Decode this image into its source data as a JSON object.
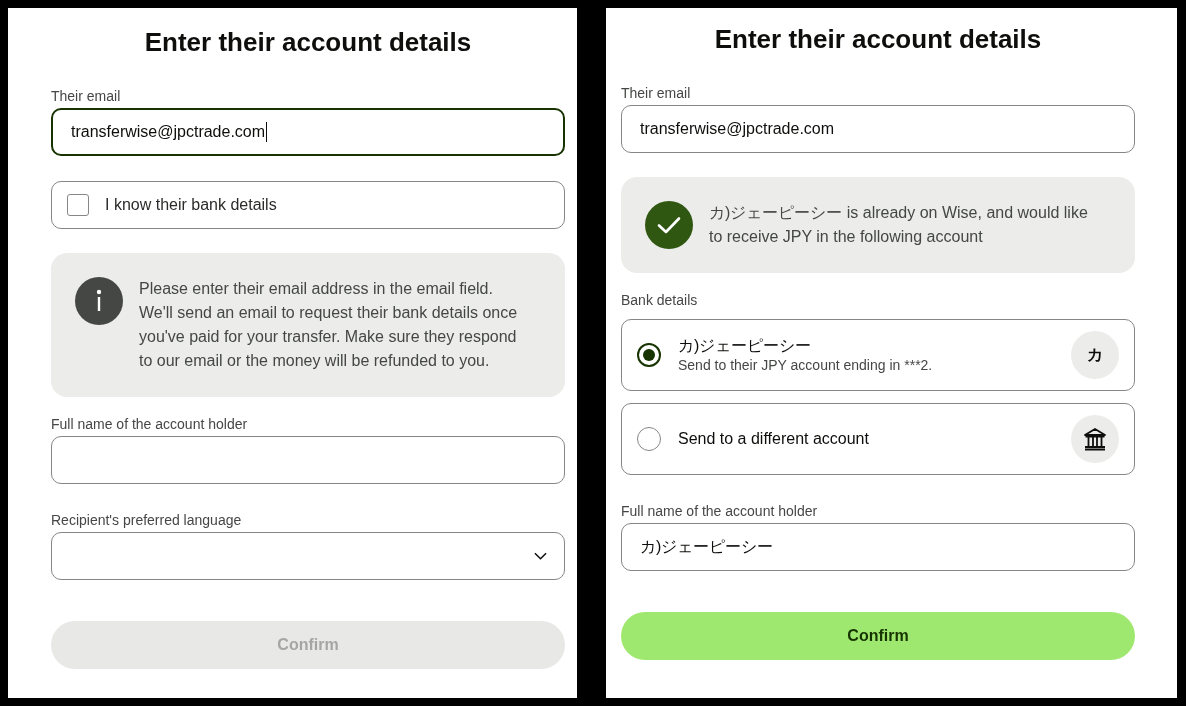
{
  "panels": [
    {
      "title": "Enter their account details",
      "items": [
        {
          "kind": "text_field",
          "label": "Their email",
          "value": "transferwise@jpctrade.com",
          "focused": true
        },
        {
          "kind": "checkbox",
          "label": "I know their bank details",
          "checked": false
        },
        {
          "kind": "info_notice",
          "text": "Please enter their email address in the email field. We'll send an email to request their bank details once you've paid for your transfer. Make sure they respond to our email or the money will be refunded to you."
        },
        {
          "kind": "text_field",
          "label": "Full name of the account holder",
          "focused": false
        },
        {
          "kind": "select",
          "label": "Recipient's preferred language"
        },
        {
          "kind": "button",
          "label": "Confirm",
          "disabled": true
        }
      ]
    },
    {
      "title": "Enter their account details",
      "items": [
        {
          "kind": "text_field",
          "label": "Their email",
          "value": "transferwise@jpctrade.com",
          "focused": false
        },
        {
          "kind": "success_notice",
          "text": "カ)ジェーピーシー is already on Wise, and would like to receive JPY in the following account"
        },
        {
          "kind": "radio_group",
          "label": "Bank details",
          "options": [
            {
              "kind": "initial",
              "title": "カ)ジェーピーシー",
              "subtitle": "Send to their JPY account ending in ***2.",
              "initial": "カ",
              "selected": true
            },
            {
              "kind": "bank",
              "title": "Send to a different account",
              "selected": false
            }
          ]
        },
        {
          "kind": "text_field",
          "label": "Full name of the account holder",
          "value": "カ)ジェーピーシー",
          "focused": false
        },
        {
          "kind": "button",
          "label": "Confirm",
          "disabled": false
        }
      ]
    }
  ]
}
